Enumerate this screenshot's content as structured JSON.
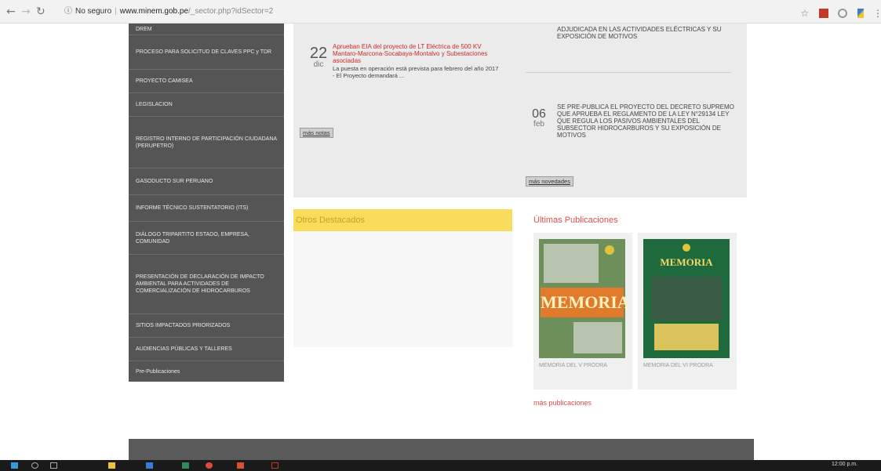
{
  "browser": {
    "back_icon": "arrow-left-icon",
    "forward_icon": "arrow-right-icon",
    "reload_icon": "reload-icon",
    "security_label": "No seguro",
    "url_domain": "www.minem.gob.pe",
    "url_path": "/_sector.php?idSector=2",
    "star_icon": "star-icon",
    "ext_icons": [
      "office-icon",
      "circle-icon",
      "pen-icon"
    ],
    "menu_icon": "kebab-menu-icon"
  },
  "sidebar": {
    "items": [
      {
        "label": "DREM"
      },
      {
        "label": "PROCESO PARA SOLICITUD DE CLAVES PPC y TDR"
      },
      {
        "label": "PROYECTO CAMISEA"
      },
      {
        "label": "LEGISLACION"
      },
      {
        "label": "REGISTRO INTERNO DE PARTICIPACIÓN CIUDADANA (PERUPETRO)"
      },
      {
        "label": "GASODUCTO SUR PERUANO"
      },
      {
        "label": "INFORME TÉCNICO SUSTENTATORIO (ITS)"
      },
      {
        "label": "DIÁLOGO TRIPARTITO ESTADO, EMPRESA, COMUNIDAD"
      },
      {
        "label": "PRESENTACIÓN DE DECLARACIÓN DE IMPACTO AMBIENTAL PARA ACTIVIDADES DE COMERCIALIZACIÓN DE HIDROCARBUROS"
      },
      {
        "label": "SITIOS IMPACTADOS PRIORIZADOS"
      },
      {
        "label": "AUDIENCIAS PÚBLICAS Y TALLERES"
      },
      {
        "label": "Pre-Publicaciones"
      }
    ]
  },
  "news_left": {
    "day": "22",
    "month": "dic",
    "title": "Aprueban EIA del proyecto de LT Eléctrica de 500 KV Mantaro-Marcona-Socabaya-Montalvo y Subestaciones asociadas",
    "text": "La puesta en operación está prevista para febrero del año 2017 - El Proyecto demandará&nbsp;...",
    "more_label": "más notas"
  },
  "news_right": {
    "top_text": "ADJUDICADA EN LAS ACTIVIDADES ELÉCTRICAS Y SU EXPOSICIÓN DE MOTIVOS",
    "day": "06",
    "month": "feb",
    "text": "SE PRE-PUBLICA EL PROYECTO DEL DECRETO SUPREMO QUE APRUEBA EL REGLAMENTO DE LA LEY N°29134 LEY QUE REGULA LOS PASIVOS AMBIENTALES DEL SUBSECTOR HIDROCARBUROS Y SU EXPOSICIÓN DE MOTIVOS",
    "more_label": "más novedades"
  },
  "otros": {
    "title": "Otros Destacados"
  },
  "publicaciones": {
    "title": "Últimas Publicaciones",
    "cards": [
      {
        "cover_word": "MEMORIA",
        "caption": "MEMORIA DEL V PRODRA"
      },
      {
        "cover_word": "MEMORIA",
        "caption": "MEMORIA DEL VI PRODRA"
      }
    ],
    "more_label": "más publicaciones"
  },
  "taskbar": {
    "clock": "12:00 p.m.",
    "icons": [
      "windows-icon",
      "search-icon",
      "task-view-icon",
      "folder-icon",
      "store-icon",
      "excel-icon",
      "chrome-icon",
      "powerpoint-icon",
      "pdf-icon"
    ]
  },
  "colors": {
    "sidebar_bg": "#555555",
    "accent_red": "#cc2b2b",
    "highlight_yellow": "#f9dc5c"
  }
}
